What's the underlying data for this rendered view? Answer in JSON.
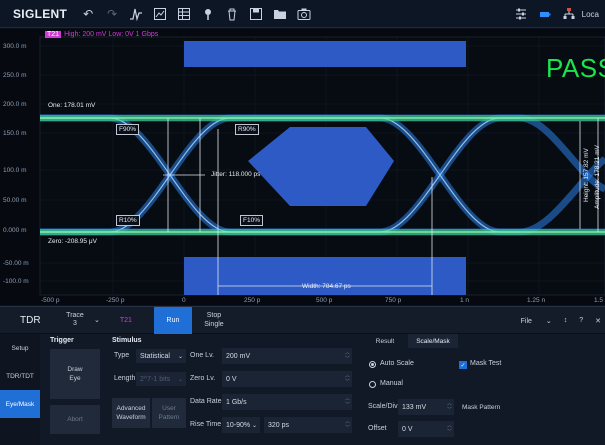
{
  "toolbar": {
    "brand": "SIGLENT",
    "right_label": "Loca"
  },
  "plot": {
    "trace_tag": "T21",
    "trigger_text": "High: 200 mV  Low: 0V  1 Gbps",
    "y_ticks": [
      "300.0 m",
      "250.0 m",
      "200.0 m",
      "150.0 m",
      "100.0 m",
      "50.00 m",
      "0.000 m",
      "-50.00 m",
      "-100.0 m"
    ],
    "x_ticks": [
      "-500 p",
      "-250 p",
      "0",
      "250 p",
      "500 p",
      "750 p",
      "1 n",
      "1.25 n",
      "1.5"
    ],
    "one_label": "One: 178.01 mV",
    "zero_label": "Zero: -208.95 μV",
    "jitter_label": "Jitter: 118.000 ps",
    "width_label": "Width: 784.67 ps",
    "height_label": "Height: 157.82 mV",
    "amplitude_label": "Amplitude: 178.21 mV",
    "markers": {
      "f90": "F90%",
      "r90": "R90%",
      "r10": "R10%",
      "f10": "F10%"
    },
    "pass_text": "PASS",
    "colors": {
      "eye": "#2e8dff",
      "level_line": "#3fe06a",
      "mask": "#2f5fd0",
      "pass": "#18e64a",
      "trace_tag": "#d23cd6"
    }
  },
  "tabbar": {
    "title": "TDR",
    "trace_label": "Trace",
    "trace_value": "3",
    "trace_ref": "T21",
    "run_label": "Run",
    "stop_line1": "Stop",
    "stop_line2": "Single",
    "file_label": "File"
  },
  "sidenav": [
    "Setup",
    "TDR/TDT",
    "Eye/Mask"
  ],
  "trigger": {
    "title": "Trigger",
    "draw_line1": "Draw",
    "draw_line2": "Eye",
    "abort": "Abort"
  },
  "stimulus": {
    "title": "Stimulus",
    "type_label": "Type",
    "type_value": "Statistical",
    "length_label": "Length",
    "length_value": "2^7-1 bits",
    "adv_line1": "Advanced",
    "adv_line2": "Waveform",
    "user_line1": "User",
    "user_line2": "Pattern",
    "one_lv_label": "One Lv.",
    "one_lv_value": "200 mV",
    "zero_lv_label": "Zero Lv.",
    "zero_lv_value": "0 V",
    "data_rate_label": "Data Rate",
    "data_rate_value": "1 Gb/s",
    "rise_time_label": "Rise Time",
    "rise_time_mode": "10-90%",
    "rise_time_value": "320 ps"
  },
  "result_tabs": [
    "Result",
    "Scale/Mask"
  ],
  "scale": {
    "auto_scale": "Auto Scale",
    "manual": "Manual",
    "scale_div_label": "Scale/Div",
    "scale_div_value": "133 mV",
    "offset_label": "Offset",
    "offset_value": "0 V",
    "mask_test": "Mask Test",
    "mask_pattern": "Mask Pattern"
  }
}
